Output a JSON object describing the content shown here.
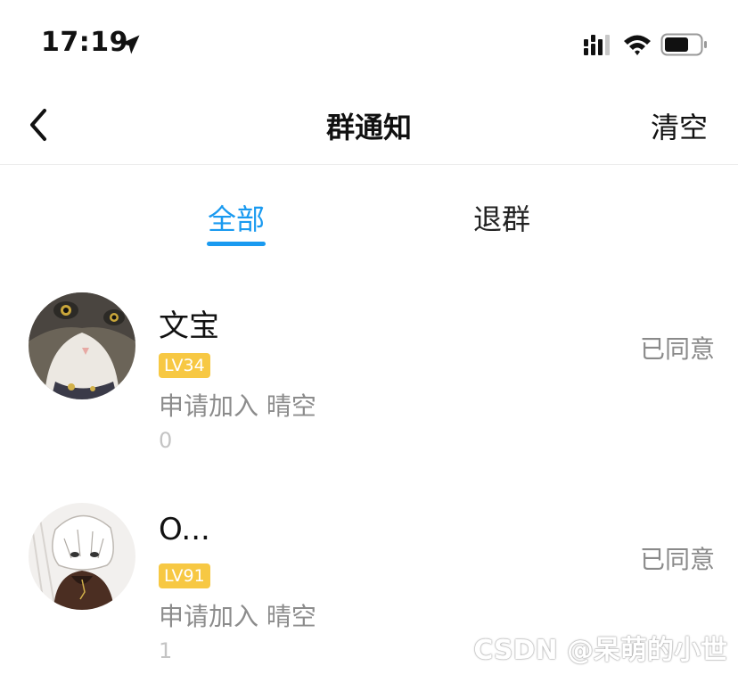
{
  "status_bar": {
    "time": "17:19"
  },
  "nav": {
    "title": "群通知",
    "clear_label": "清空"
  },
  "tabs": [
    {
      "label": "全部",
      "active": true
    },
    {
      "label": "退群",
      "active": false
    }
  ],
  "notices": [
    {
      "name": "文宝",
      "level": "LV34",
      "request": "申请加入 晴空",
      "extra": "0",
      "status": "已同意"
    },
    {
      "name": "O...",
      "level": "LV91",
      "request": "申请加入 晴空",
      "extra": "1",
      "status": "已同意"
    }
  ],
  "watermark": "CSDN @呆萌的小世",
  "colors": {
    "accent": "#1a9af0",
    "badge": "#f7c843",
    "muted": "#8c8c8c"
  }
}
